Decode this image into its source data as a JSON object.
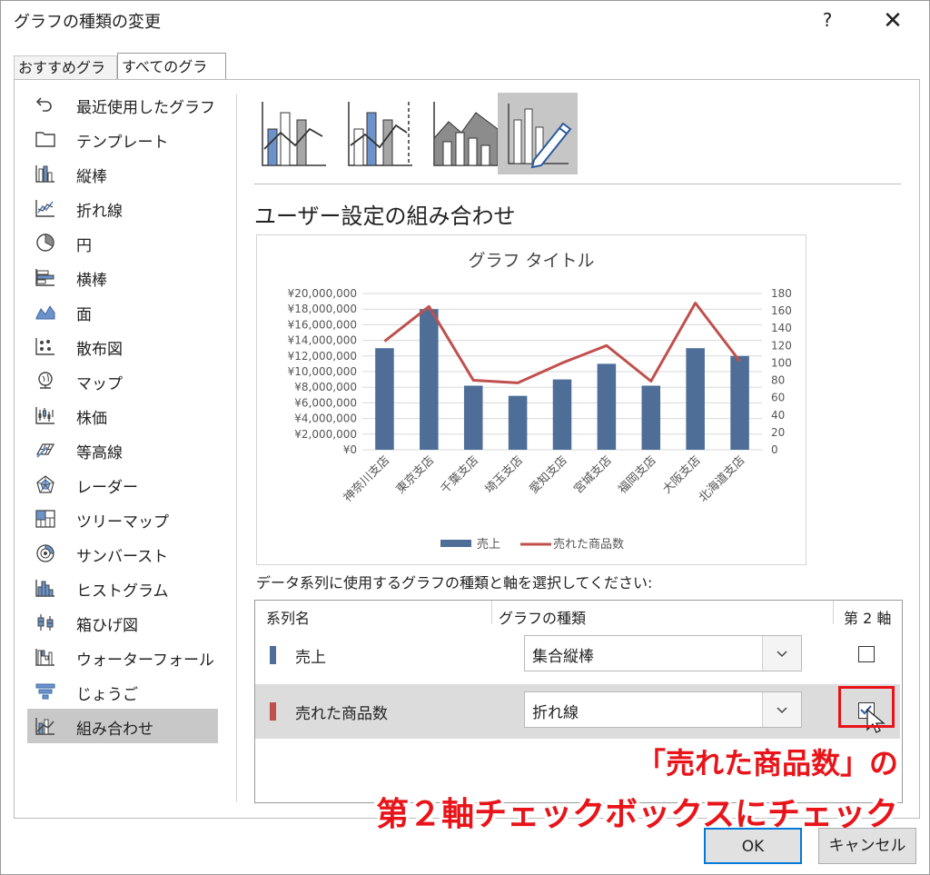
{
  "window": {
    "title": "グラフの種類の変更",
    "help": "?",
    "close": "✕"
  },
  "tabs": [
    {
      "label": "おすすめグラフ"
    },
    {
      "label": "すべてのグラフ"
    }
  ],
  "sidebar": {
    "items": [
      {
        "label": "最近使用したグラフ",
        "icon": "recent-icon"
      },
      {
        "label": "テンプレート",
        "icon": "template-folder-icon"
      },
      {
        "label": "縦棒",
        "icon": "column-chart-icon"
      },
      {
        "label": "折れ線",
        "icon": "line-chart-icon"
      },
      {
        "label": "円",
        "icon": "pie-chart-icon"
      },
      {
        "label": "横棒",
        "icon": "bar-chart-icon"
      },
      {
        "label": "面",
        "icon": "area-chart-icon"
      },
      {
        "label": "散布図",
        "icon": "scatter-chart-icon"
      },
      {
        "label": "マップ",
        "icon": "map-globe-icon"
      },
      {
        "label": "株価",
        "icon": "stock-chart-icon"
      },
      {
        "label": "等高線",
        "icon": "surface-chart-icon"
      },
      {
        "label": "レーダー",
        "icon": "radar-chart-icon"
      },
      {
        "label": "ツリーマップ",
        "icon": "treemap-icon"
      },
      {
        "label": "サンバースト",
        "icon": "sunburst-icon"
      },
      {
        "label": "ヒストグラム",
        "icon": "histogram-icon"
      },
      {
        "label": "箱ひげ図",
        "icon": "box-whisker-icon"
      },
      {
        "label": "ウォーターフォール",
        "icon": "waterfall-icon"
      },
      {
        "label": "じょうご",
        "icon": "funnel-icon"
      },
      {
        "label": "組み合わせ",
        "icon": "combo-chart-icon",
        "active": true
      }
    ]
  },
  "subtypes": [
    {
      "icon": "combo-column-line-icon"
    },
    {
      "icon": "combo-column-line-secondary-icon"
    },
    {
      "icon": "combo-area-column-icon"
    },
    {
      "icon": "custom-combo-pencil-icon",
      "selected": true
    }
  ],
  "section_title": "ユーザー設定の組み合わせ",
  "chart_data": {
    "type": "bar",
    "title": "グラフ タイトル",
    "categories": [
      "神奈川支店",
      "東京支店",
      "千葉支店",
      "埼玉支店",
      "愛知支店",
      "宮城支店",
      "福岡支店",
      "大阪支店",
      "北海道支店"
    ],
    "series": [
      {
        "name": "売上",
        "type": "bar",
        "axis": "primary",
        "color": "#4e6d97",
        "values": [
          13000000,
          18000000,
          8200000,
          6900000,
          9000000,
          11000000,
          8200000,
          13000000,
          12000000
        ]
      },
      {
        "name": "売れた商品数",
        "type": "line",
        "axis": "secondary",
        "color": "#c0504d",
        "values": [
          125,
          165,
          80,
          77,
          100,
          120,
          79,
          169,
          102
        ]
      }
    ],
    "ylim": [
      0,
      20000000
    ],
    "y_ticks": [
      "¥20,000,000",
      "¥18,000,000",
      "¥16,000,000",
      "¥14,000,000",
      "¥12,000,000",
      "¥10,000,000",
      "¥8,000,000",
      "¥6,000,000",
      "¥4,000,000",
      "¥2,000,000",
      "¥0"
    ],
    "y2lim": [
      0,
      180
    ],
    "y2_ticks": [
      "180",
      "160",
      "140",
      "120",
      "100",
      "80",
      "60",
      "40",
      "20",
      "0"
    ],
    "grid": true,
    "legend": "bottom"
  },
  "series_select": {
    "label": "データ系列に使用するグラフの種類と軸を選択してください:",
    "headers": {
      "name": "系列名",
      "type": "グラフの種類",
      "axis2": "第 2 軸"
    },
    "rows": [
      {
        "name": "売上",
        "type": "集合縦棒",
        "secondary": false,
        "color": "#4e6d97"
      },
      {
        "name": "売れた商品数",
        "type": "折れ線",
        "secondary": true,
        "color": "#c0504d"
      }
    ]
  },
  "annotation": {
    "line1": "「売れた商品数」の",
    "line2": "第２軸チェックボックスにチェック",
    "color": "#e8141a"
  },
  "buttons": {
    "ok": "OK",
    "cancel": "キャンセル"
  }
}
